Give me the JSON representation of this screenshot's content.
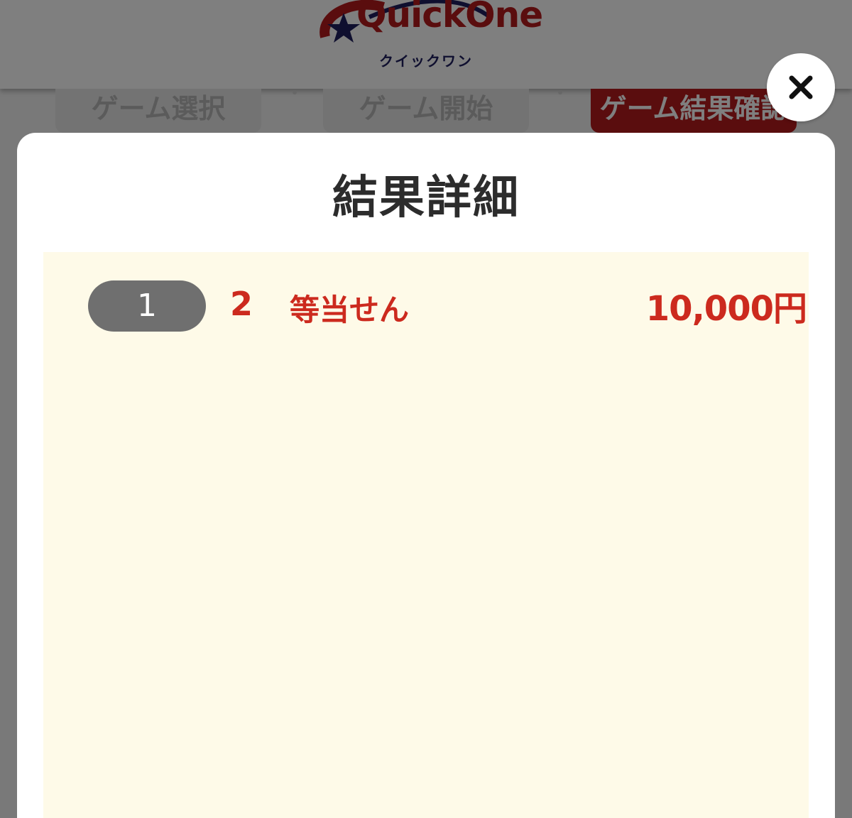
{
  "app": {
    "logo_text": "QuickOne",
    "logo_subtext": "クイックワン"
  },
  "steps": [
    {
      "label": "ゲーム選択",
      "active": false
    },
    {
      "label": "ゲーム開始",
      "active": false
    },
    {
      "label": "ゲーム結果確認",
      "active": true
    }
  ],
  "modal": {
    "title": "結果詳細",
    "close_icon": "close-icon",
    "results": [
      {
        "index": "1",
        "rank": "2",
        "label": "等当せん",
        "amount": "10,000円"
      }
    ]
  },
  "colors": {
    "brand_red": "#b51a1d",
    "result_text": "#cc2a1e",
    "panel_bg": "#fefae8",
    "index_pill": "#6f6f6f"
  }
}
